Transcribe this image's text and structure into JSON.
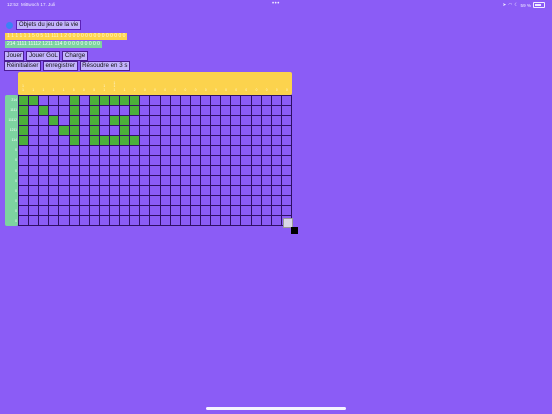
{
  "status_bar": {
    "time": "12:52",
    "date": "Mittwoch 17. Juli",
    "battery": "59 %"
  },
  "title": "Objets du jeu de la vie",
  "clue_strips": {
    "top": "1 1 1 1 1 1 5 0 5 11 111 1 2 0 0 0 0 0 0 0 0 0 0 0 0 0 0",
    "side": "214 1111 11112 1211 114 0 0 0 0 0 0 0 0 0"
  },
  "buttons": {
    "play": "Jouer",
    "play_gol": "Jouer GoL",
    "load": "Charge",
    "reset": "Réinitialiser",
    "save": "enregistrer",
    "solve": "Résoudre en 3 s"
  },
  "puzzle": {
    "cols": 27,
    "rows": 13,
    "col_clues": [
      "1\n1",
      "1",
      "1",
      "1",
      "1",
      "5",
      "0",
      "5",
      "1\n1",
      "1\n1\n1",
      "1",
      "2",
      "0",
      "0",
      "0",
      "0",
      "0",
      "0",
      "0",
      "0",
      "0",
      "0",
      "0",
      "0",
      "0",
      "0",
      "0"
    ],
    "row_clues": [
      "214",
      "1111",
      "11112",
      "1211",
      "114",
      "0",
      "0",
      "0",
      "0",
      "0",
      "0",
      "0",
      "0"
    ],
    "filled": [
      [
        0,
        0
      ],
      [
        0,
        1
      ],
      [
        0,
        5
      ],
      [
        0,
        7
      ],
      [
        0,
        8
      ],
      [
        0,
        9
      ],
      [
        0,
        10
      ],
      [
        0,
        11
      ],
      [
        1,
        0
      ],
      [
        1,
        2
      ],
      [
        1,
        5
      ],
      [
        1,
        7
      ],
      [
        1,
        11
      ],
      [
        2,
        0
      ],
      [
        2,
        3
      ],
      [
        2,
        5
      ],
      [
        2,
        7
      ],
      [
        2,
        9
      ],
      [
        2,
        10
      ],
      [
        3,
        0
      ],
      [
        3,
        4
      ],
      [
        3,
        5
      ],
      [
        3,
        7
      ],
      [
        3,
        10
      ],
      [
        4,
        0
      ],
      [
        4,
        5
      ],
      [
        4,
        7
      ],
      [
        4,
        8
      ],
      [
        4,
        9
      ],
      [
        4,
        10
      ],
      [
        4,
        11
      ]
    ]
  },
  "colors": {
    "background": "#8b5cf6",
    "filled_cell": "#4caf3a",
    "top_clue_bg": "#fcd34d",
    "side_clue_bg": "#7dd3a0",
    "button_bg": "#c4b5fd",
    "icon": "#3b82f6"
  },
  "icons": {
    "app": "circle-icon",
    "wifi": "wifi-icon",
    "moon": "moon-icon",
    "battery": "battery-icon"
  }
}
